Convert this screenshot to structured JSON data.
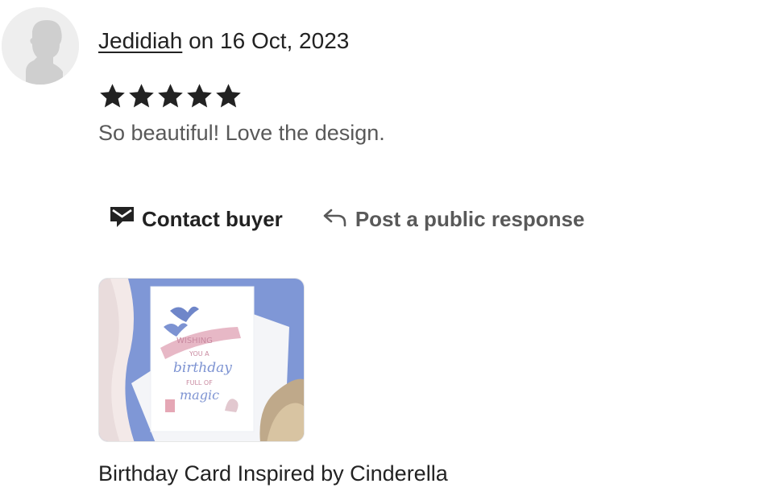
{
  "review": {
    "reviewer_name": "Jedidiah",
    "date_text": "on 16 Oct, 2023",
    "rating": 5,
    "max_rating": 5,
    "text": "So beautiful! Love the design."
  },
  "actions": {
    "contact_buyer_label": "Contact buyer",
    "public_response_label": "Post a public response"
  },
  "product": {
    "title": "Birthday Card Inspired by Cinderella",
    "card_lines": [
      "WISHING",
      "YOU A",
      "birthday",
      "FULL OF",
      "magic"
    ]
  },
  "colors": {
    "star": "#222222",
    "text_primary": "#222222",
    "text_secondary": "#595959",
    "card_background": "#7f97d6"
  },
  "icons": {
    "avatar": "default-avatar-silhouette-icon",
    "star": "filled-star-icon",
    "contact": "envelope-icon",
    "respond": "reply-arrow-icon"
  }
}
